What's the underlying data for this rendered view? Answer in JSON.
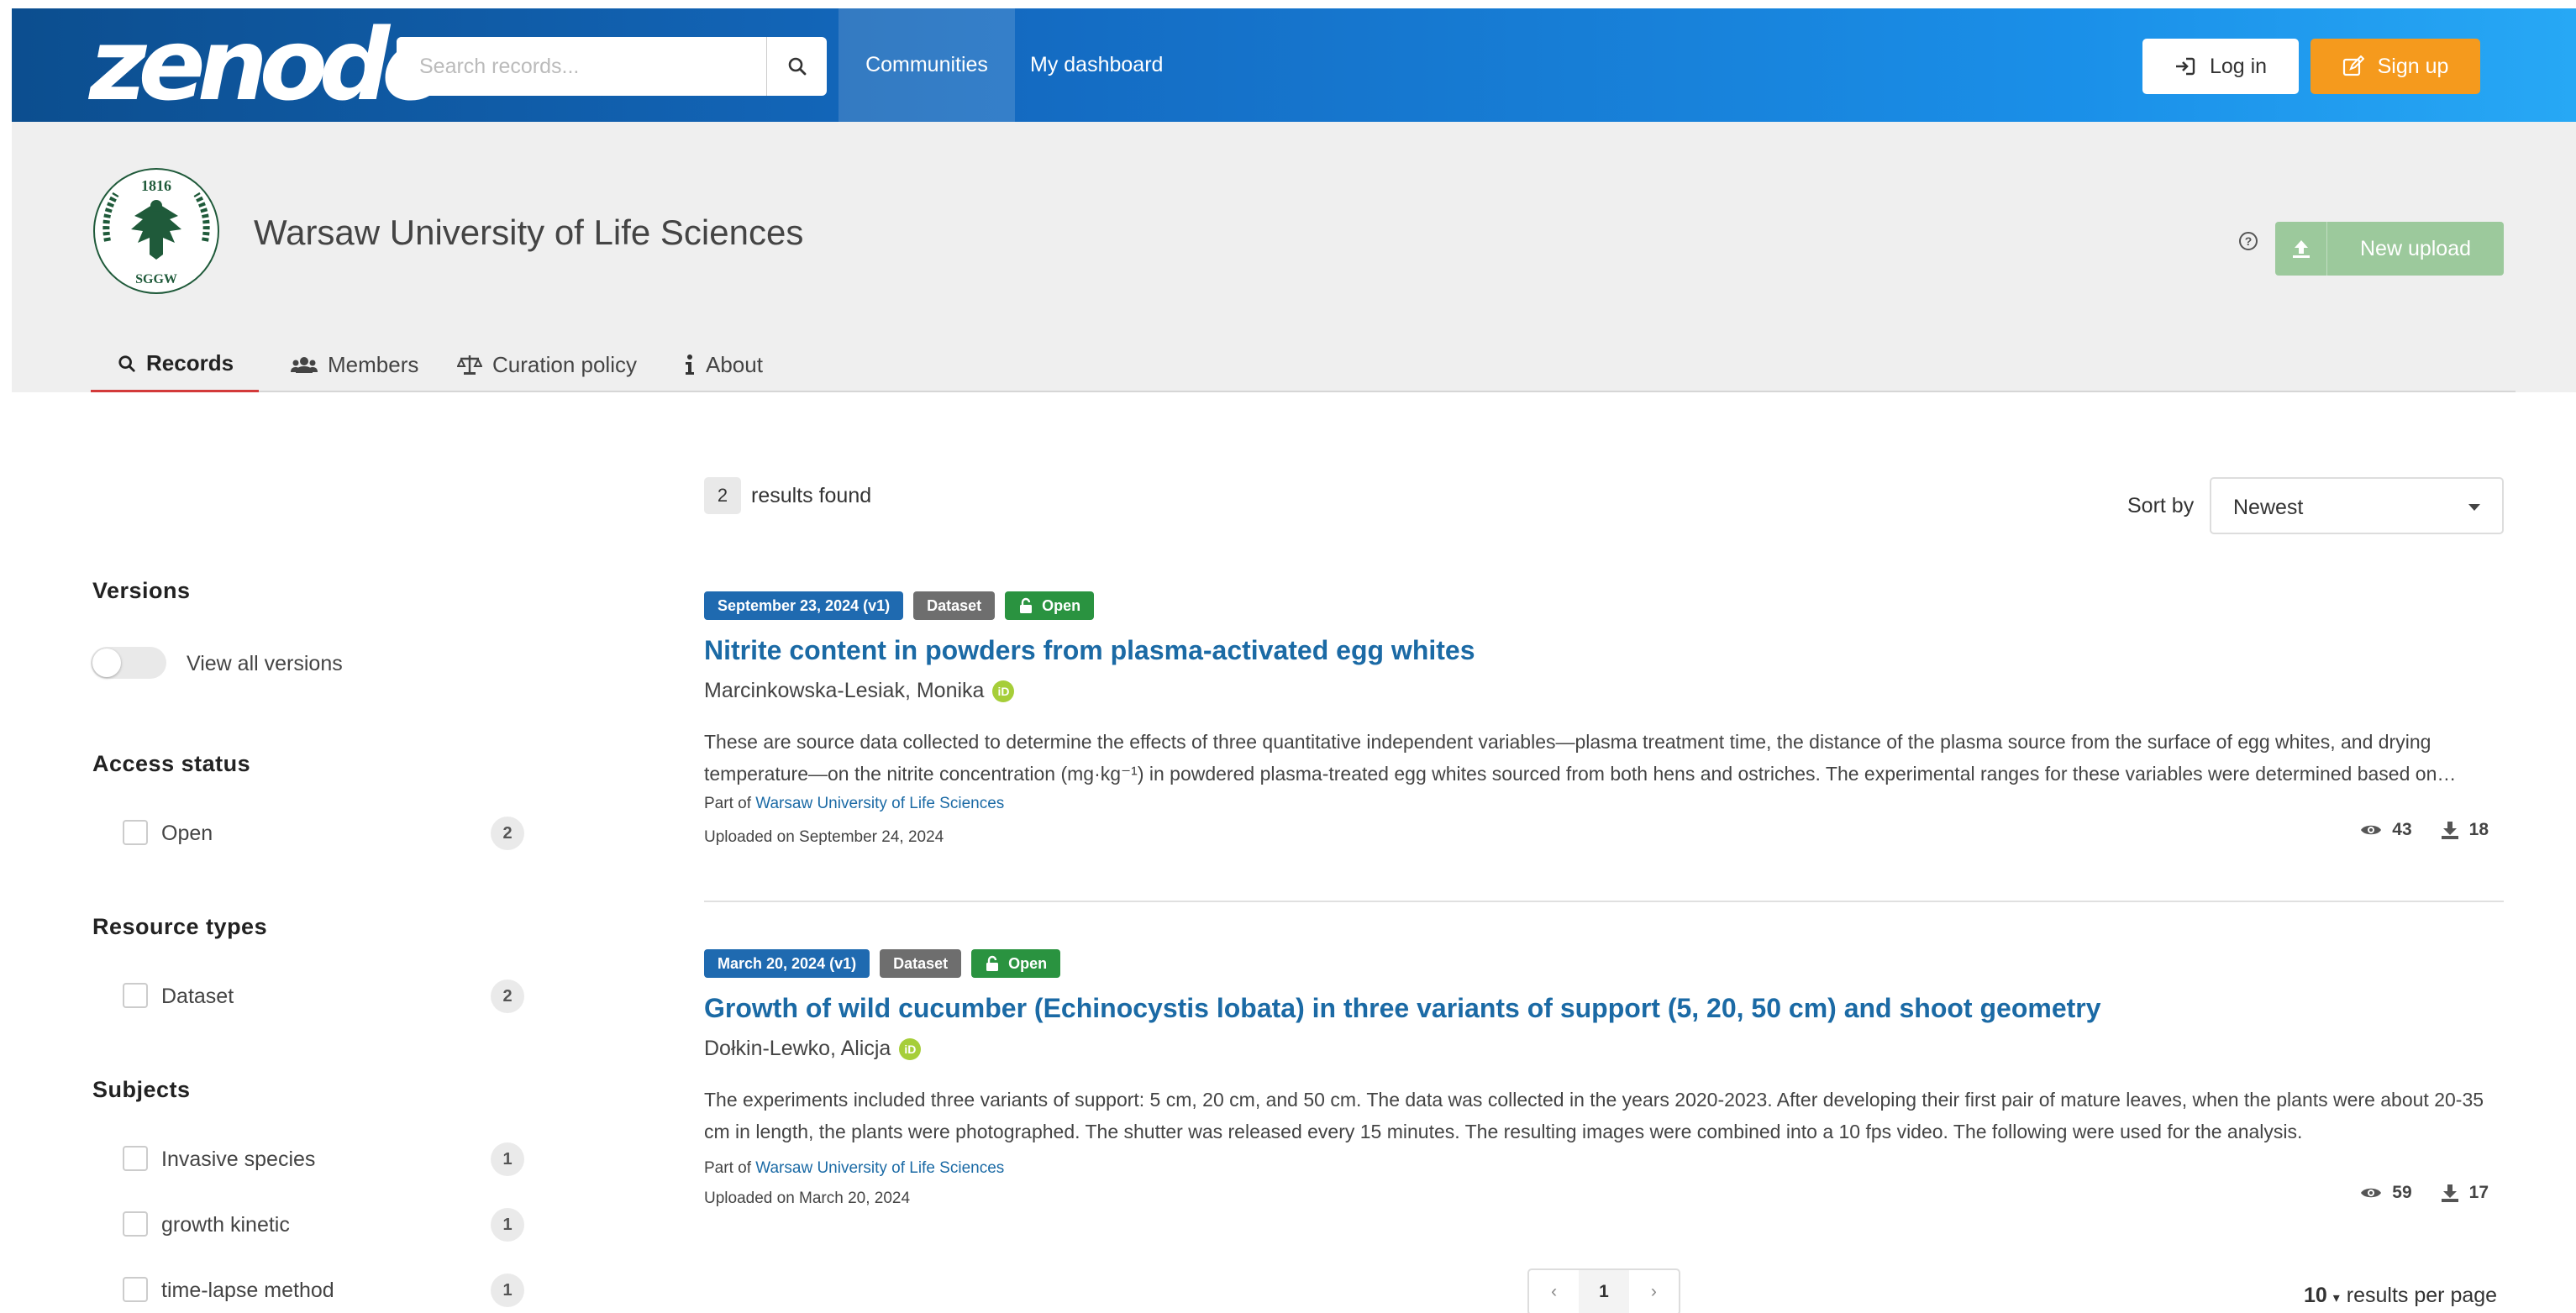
{
  "header": {
    "logo": "zenodo",
    "search_placeholder": "Search records...",
    "nav": {
      "communities": "Communities",
      "dashboard": "My dashboard"
    },
    "login": "Log in",
    "signup": "Sign up",
    "colors": {
      "header_start": "#0c4e8f",
      "header_end": "#27a8f5",
      "signup": "#f59a1d"
    }
  },
  "community": {
    "name": "Warsaw University of Life Sciences",
    "seal_text": "1816 SGGW",
    "new_upload": "New upload",
    "tabs": [
      {
        "label": "Records",
        "icon": "search-icon",
        "active": true
      },
      {
        "label": "Members",
        "icon": "users-icon",
        "active": false
      },
      {
        "label": "Curation policy",
        "icon": "scale-icon",
        "active": false
      },
      {
        "label": "About",
        "icon": "info-icon",
        "active": false
      }
    ]
  },
  "facets": {
    "versions": {
      "title": "Versions",
      "toggle_label": "View all versions",
      "enabled": false
    },
    "access_status": {
      "title": "Access status",
      "items": [
        {
          "label": "Open",
          "count": "2"
        }
      ]
    },
    "resource_types": {
      "title": "Resource types",
      "items": [
        {
          "label": "Dataset",
          "count": "2"
        }
      ]
    },
    "subjects": {
      "title": "Subjects",
      "items": [
        {
          "label": "Invasive species",
          "count": "1"
        },
        {
          "label": "growth kinetic",
          "count": "1"
        },
        {
          "label": "time-lapse method",
          "count": "1"
        }
      ]
    }
  },
  "results": {
    "count": "2",
    "label": "results found",
    "sort_label": "Sort by",
    "sort_value": "Newest",
    "records": [
      {
        "date_badge": "September 23, 2024 (v1)",
        "type_badge": "Dataset",
        "access_badge": "Open",
        "title": "Nitrite content in powders from plasma-activated egg whites",
        "author": "Marcinkowska-Lesiak, Monika",
        "description": "These are source data collected to determine the effects of three quantitative independent variables—plasma treatment time, the distance of the plasma source from the surface of egg whites, and drying temperature—on the nitrite concentration (mg·kg⁻¹) in powdered plasma-treated egg whites sourced from both hens and ostriches. The experimental ranges for these variables were determined based on preliminary studies and literature.",
        "part_of_prefix": "Part of",
        "part_of_link": "Warsaw University of Life Sciences",
        "uploaded": "Uploaded on September 24, 2024",
        "views": "43",
        "downloads": "18"
      },
      {
        "date_badge": "March 20, 2024 (v1)",
        "type_badge": "Dataset",
        "access_badge": "Open",
        "title": "Growth of wild cucumber (Echinocystis lobata) in three variants of support (5, 20, 50 cm) and shoot geometry",
        "author": "Dołkin-Lewko, Alicja",
        "description": "The experiments included three variants of support: 5 cm, 20 cm, and 50 cm. The data was collected in the years 2020-2023. After developing their first pair of mature leaves, when the plants were about 20-35 cm in length, the plants were photographed. The shutter was released every 15 minutes. The resulting images were combined into a 10 fps video. The following were used for the analysis.",
        "part_of_prefix": "Part of",
        "part_of_link": "Warsaw University of Life Sciences",
        "uploaded": "Uploaded on March 20, 2024",
        "views": "59",
        "downloads": "17"
      }
    ]
  },
  "pagination": {
    "prev": "‹",
    "current": "1",
    "next": "›",
    "per_page_value": "10",
    "per_page_label": "results per page"
  }
}
